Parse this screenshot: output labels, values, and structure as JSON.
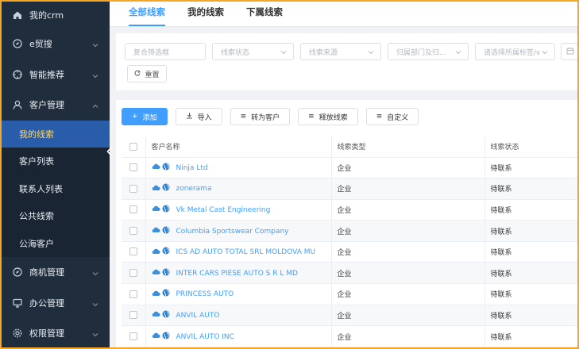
{
  "sidebar": {
    "home": {
      "label": "我的crm",
      "icon": "home-icon"
    },
    "menus": [
      {
        "label": "e贸搜",
        "icon": "compass-icon"
      },
      {
        "label": "智能推荐",
        "icon": "crosshair-icon"
      },
      {
        "label": "客户管理",
        "icon": "user-icon",
        "expanded": true
      }
    ],
    "subitems": [
      "我的线索",
      "客户列表",
      "联系人列表",
      "公共线索",
      "公海客户"
    ],
    "active_subitem": "我的线索",
    "bottom_menus": [
      {
        "label": "商机管理",
        "icon": "compass-icon"
      },
      {
        "label": "办公管理",
        "icon": "monitor-icon"
      },
      {
        "label": "权限管理",
        "icon": "settings-icon"
      }
    ]
  },
  "tabs": [
    "全部线索",
    "我的线索",
    "下属线索"
  ],
  "active_tab": "全部线索",
  "filters": {
    "keyword_placeholder": "复合筛选框",
    "status_placeholder": "线索状态",
    "source_placeholder": "线索来源",
    "dept_placeholder": "归属部门及归...",
    "group_placeholder": "请选择所属标签/ν",
    "reset_label": "重置"
  },
  "toolbar": {
    "add": "添加",
    "import": "导入",
    "convert": "转为客户",
    "release": "释放线索",
    "custom": "自定义"
  },
  "table": {
    "columns": [
      "客户名称",
      "线索类型",
      "线索状态"
    ],
    "rows": [
      {
        "name": "Ninja Ltd",
        "type": "企业",
        "status": "待联系"
      },
      {
        "name": "zonerama",
        "type": "企业",
        "status": "待联系"
      },
      {
        "name": "Vk Metal Cast Engineering",
        "type": "企业",
        "status": "待联系"
      },
      {
        "name": "Columbia Sportswear Company",
        "type": "企业",
        "status": "待联系"
      },
      {
        "name": "ICS AD AUTO TOTAL SRL MOLDOVA MU",
        "type": "企业",
        "status": "待联系"
      },
      {
        "name": "INTER CARS PIESE AUTO S R L MD",
        "type": "企业",
        "status": "待联系"
      },
      {
        "name": "PRINCESS AUTO",
        "type": "企业",
        "status": "待联系"
      },
      {
        "name": "ANVIL AUTO",
        "type": "企业",
        "status": "待联系"
      },
      {
        "name": "ANVIL AUTO INC",
        "type": "企业",
        "status": "待联系"
      }
    ]
  },
  "colors": {
    "sidebar_bg": "#1f2d3d",
    "active_bg": "#2a5da9",
    "active_text": "#ffd66b",
    "accent": "#409eff",
    "frame": "#f5a623"
  }
}
